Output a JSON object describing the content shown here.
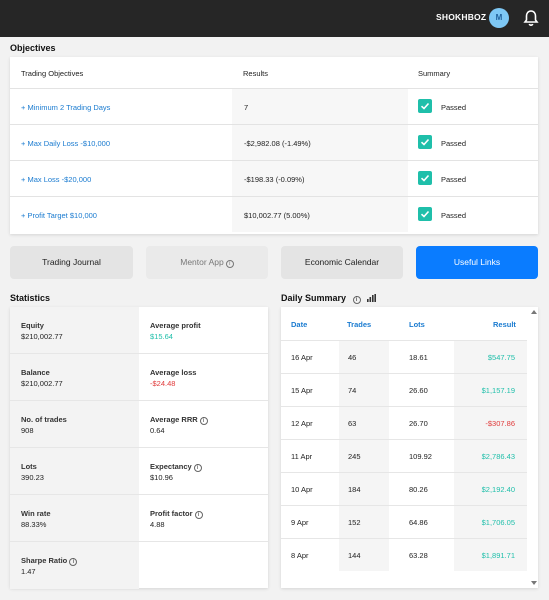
{
  "header": {
    "username": "SHOKHBOZ",
    "avatar_initial": "M",
    "bell_icon": "bell-icon"
  },
  "objectives": {
    "title": "Objectives",
    "columns": [
      "Trading Objectives",
      "Results",
      "Summary"
    ],
    "rows": [
      {
        "name": "+ Minimum 2 Trading Days",
        "result": "7",
        "summary": "Passed"
      },
      {
        "name": "+ Max Daily Loss -$10,000",
        "result": "-$2,982.08 (-1.49%)",
        "summary": "Passed"
      },
      {
        "name": "+ Max Loss -$20,000",
        "result": "-$198.33 (-0.09%)",
        "summary": "Passed"
      },
      {
        "name": "+ Profit Target $10,000",
        "result": "$10,002.77 (5.00%)",
        "summary": "Passed"
      }
    ],
    "check_color": "#1fbfaa"
  },
  "tabs": {
    "trading_journal": "Trading Journal",
    "mentor_app": "Mentor App",
    "economic_calendar": "Economic Calendar",
    "useful_links": "Useful Links",
    "info_symbol": "i",
    "accent": "#0a7cff"
  },
  "statistics": {
    "title": "Statistics",
    "left": [
      {
        "label": "Equity",
        "value": "$210,002.77"
      },
      {
        "label": "Balance",
        "value": "$210,002.77"
      },
      {
        "label": "No. of trades",
        "value": "908"
      },
      {
        "label": "Lots",
        "value": "390.23"
      },
      {
        "label": "Win rate",
        "value": "88.33%"
      },
      {
        "label": "Sharpe Ratio",
        "value": "1.47"
      }
    ],
    "right": [
      {
        "label": "Average profit",
        "value": "$15.64"
      },
      {
        "label": "Average loss",
        "value": "-$24.48"
      },
      {
        "label": "Average RRR",
        "value": "0.64"
      },
      {
        "label": "Expectancy",
        "value": "$10.96"
      },
      {
        "label": "Profit factor",
        "value": "4.88"
      }
    ]
  },
  "daily_summary": {
    "title": "Daily Summary",
    "columns": [
      "Date",
      "Trades",
      "Lots",
      "Result"
    ],
    "rows": [
      {
        "date": "16 Apr",
        "trades": "46",
        "lots": "18.61",
        "result": "$547.75"
      },
      {
        "date": "15 Apr",
        "trades": "74",
        "lots": "26.60",
        "result": "$1,157.19"
      },
      {
        "date": "12 Apr",
        "trades": "63",
        "lots": "26.70",
        "result": "-$307.86"
      },
      {
        "date": "11 Apr",
        "trades": "245",
        "lots": "109.92",
        "result": "$2,786.43"
      },
      {
        "date": "10 Apr",
        "trades": "184",
        "lots": "80.26",
        "result": "$2,192.40"
      },
      {
        "date": "9 Apr",
        "trades": "152",
        "lots": "64.86",
        "result": "$1,706.05"
      },
      {
        "date": "8 Apr",
        "trades": "144",
        "lots": "63.28",
        "result": "$1,891.71"
      }
    ],
    "positive_color": "#1fbfaa",
    "negative_color": "#e03a3a"
  }
}
